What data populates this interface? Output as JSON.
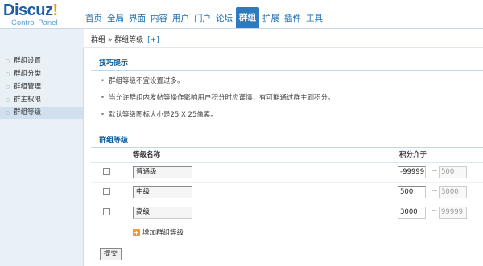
{
  "logo": {
    "main": "Discuz",
    "bang": "!",
    "sub": "Control Panel"
  },
  "nav": [
    {
      "label": "首页",
      "active": false
    },
    {
      "label": "全局",
      "active": false
    },
    {
      "label": "界面",
      "active": false
    },
    {
      "label": "内容",
      "active": false
    },
    {
      "label": "用户",
      "active": false
    },
    {
      "label": "门户",
      "active": false
    },
    {
      "label": "论坛",
      "active": false
    },
    {
      "label": "群组",
      "active": true
    },
    {
      "label": "扩展",
      "active": false
    },
    {
      "label": "插件",
      "active": false
    },
    {
      "label": "工具",
      "active": false
    }
  ],
  "breadcrumb": {
    "root": "群组",
    "sep": "»",
    "current": "群组等级",
    "plus": "[+]"
  },
  "sidebar": [
    {
      "label": "群组设置",
      "active": false
    },
    {
      "label": "群组分类",
      "active": false
    },
    {
      "label": "群组管理",
      "active": false
    },
    {
      "label": "群主权限",
      "active": false
    },
    {
      "label": "群组等级",
      "active": true
    }
  ],
  "tips": {
    "title": "技巧提示",
    "items": [
      "群组等级不宜设置过多。",
      "当允许群组内发帖等操作影响用户积分时应谨慎，有可能通过群主刷积分。",
      "默认等级图标大小是25 X 25像素。"
    ]
  },
  "levels": {
    "title": "群组等级",
    "col_name": "等级名称",
    "col_points": "积分介于",
    "rows": [
      {
        "name": "普通级",
        "from": "-99999",
        "tilde": "~",
        "to": "500"
      },
      {
        "name": "中级",
        "from": "500",
        "tilde": "~",
        "to": "3000"
      },
      {
        "name": "高级",
        "from": "3000",
        "tilde": "~",
        "to": "99999"
      }
    ],
    "add_icon": "plus-icon",
    "add_label": "增加群组等级",
    "submit": "提交"
  }
}
